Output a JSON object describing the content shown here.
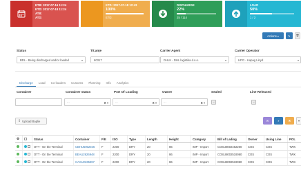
{
  "cards": [
    {
      "color": "#d9534f",
      "icon": "calendar-icon",
      "lines": [
        "ETB: 2017-07-16 11:24",
        "ETD: 2017-07-18 11:24",
        "ATB:",
        "ATD:"
      ]
    },
    {
      "color": "#f0ad4e",
      "icon": "none",
      "lines": [
        "ETD: 2017-07-18 12:43",
        "100%",
        "ETD:"
      ],
      "progress": 1.0
    },
    {
      "color": "#2f9e59",
      "icon": "arrow-down-circle-icon",
      "lines": [
        "DISCHARGE",
        "22%",
        "25 / 114"
      ],
      "progress": 0.22
    },
    {
      "color": "#25b7d3",
      "icon": "arrow-up-circle-icon",
      "lines": [
        "LOAD",
        "50%",
        "1 / 2"
      ],
      "progress": 0.5
    }
  ],
  "top_buttons": {
    "actions": "Actions ▾",
    "edit_icon": "edit-icon",
    "third_icon": "delete-icon"
  },
  "filters": {
    "status_label": "Status",
    "status_value": "BDL - Being discharged and/or loaded",
    "terminal_label": "Tit.anje",
    "terminal_value": "60317",
    "agent_label": "Carrier Agent",
    "agent_value": "DHLK - DHL logistika d.o.o.",
    "operator_label": "Carrier Operator",
    "operator_value": "HPG - Hapag Lloyd"
  },
  "tabs": [
    "Discharge",
    "Load",
    "Co-loaders",
    "Customs",
    "Planning",
    "Info",
    "Analytics"
  ],
  "search": {
    "container_label": "Container",
    "status_label": "Container status",
    "port_label": "Port Of Loading",
    "owner_label": "Owner",
    "sealed_label": "Sealed",
    "released_label": "Line Released",
    "placeholder": "...",
    "clear": "✖ ▾"
  },
  "upload_label": "Upload Baplie",
  "table": {
    "headers": [
      "⚙",
      "",
      "Status",
      "Container",
      "F/E",
      "ISO",
      "Type",
      "Length",
      "Height",
      "Category",
      "Bill of Lading",
      "Owner",
      "Using Line",
      "POL"
    ],
    "rows": [
      [
        "OTT - On the Terminal",
        "CBHU5052026",
        "F",
        "2200",
        "DRY",
        "20",
        "86",
        "IMP - Import",
        "COSU8002462200",
        "COS",
        "COS",
        "TWK"
      ],
      [
        "OTT - On the Terminal",
        "BEAU2626948",
        "F",
        "2200",
        "DRY",
        "20",
        "86",
        "IMP - Import",
        "COSU8002519060",
        "COS",
        "COS",
        "TWK"
      ],
      [
        "OTT - On the Terminal",
        "CAXU2235397",
        "F",
        "2200",
        "DRY",
        "20",
        "86",
        "IMP - Import",
        "COSU8002519060",
        "COS",
        "COS",
        "TWK"
      ]
    ]
  }
}
